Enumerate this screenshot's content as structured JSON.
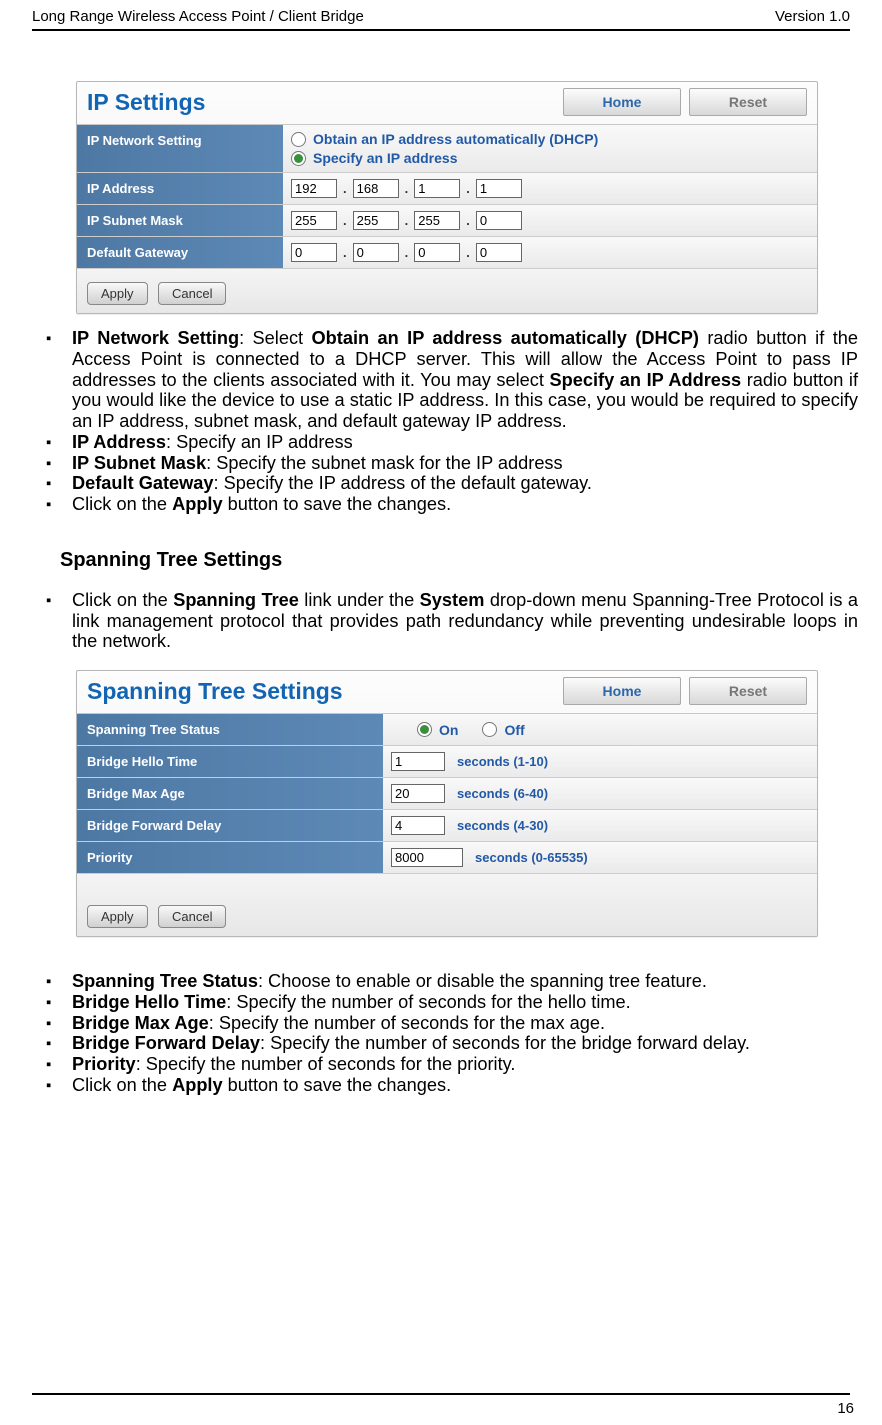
{
  "header": {
    "left": "Long Range Wireless Access Point / Client Bridge",
    "right": "Version 1.0"
  },
  "ip": {
    "title": "IP Settings",
    "btn_home": "Home",
    "btn_reset": "Reset",
    "rows": {
      "netset": "IP Network Setting",
      "opt_dhcp": "Obtain an IP address automatically (DHCP)",
      "opt_static": "Specify an IP address",
      "addr": "IP Address",
      "mask": "IP Subnet Mask",
      "gw": "Default Gateway"
    },
    "vals": {
      "addr": [
        "192",
        "168",
        "1",
        "1"
      ],
      "mask": [
        "255",
        "255",
        "255",
        "0"
      ],
      "gw": [
        "0",
        "0",
        "0",
        "0"
      ]
    },
    "apply": "Apply",
    "cancel": "Cancel"
  },
  "stp": {
    "title": "Spanning Tree Settings",
    "btn_home": "Home",
    "btn_reset": "Reset",
    "rows": {
      "status": "Spanning Tree Status",
      "on": "On",
      "off": "Off",
      "hello": "Bridge Hello Time",
      "hello_r": "seconds (1-10)",
      "max": "Bridge Max Age",
      "max_r": "seconds (6-40)",
      "fwd": "Bridge Forward Delay",
      "fwd_r": "seconds (4-30)",
      "prio": "Priority",
      "prio_r": "seconds (0-65535)"
    },
    "vals": {
      "hello": "1",
      "max": "20",
      "fwd": "4",
      "prio": "8000"
    },
    "apply": "Apply",
    "cancel": "Cancel"
  },
  "text": {
    "ip_b1_a": "IP Network Setting",
    "ip_b1_b": "Obtain an IP address automatically (DHCP)",
    "ip_b1_c": "Specify an IP Address",
    "ip_b1": ": Select ",
    "ip_b1_2": " radio button if the Access Point is connected to a DHCP server. This will allow the Access Point to pass IP addresses to the clients associated with it. You may select ",
    "ip_b1_3": " radio button if you would like the device to use a static IP address. In this case, you would be required to specify an IP address, subnet mask, and default gateway IP address.",
    "ip_b2_a": "IP Address",
    "ip_b2": ": Specify an IP address",
    "ip_b3_a": "IP Subnet Mask",
    "ip_b3": ": Specify the subnet mask for the IP address",
    "ip_b4_a": "Default Gateway",
    "ip_b4": ": Specify the IP address of the default gateway.",
    "ip_b5_1": "Click on the ",
    "ip_b5_a": "Apply",
    "ip_b5_2": " button to save the changes.",
    "stp_h": "Spanning Tree Settings",
    "stp_b0_1": "Click on the ",
    "stp_b0_a": "Spanning Tree",
    "stp_b0_2": " link under the ",
    "stp_b0_b": "System",
    "stp_b0_3": " drop-down menu Spanning-Tree Protocol is a link management protocol that provides path redundancy while preventing undesirable loops in the network.",
    "stp_b1_a": "Spanning Tree Status",
    "stp_b1": ": Choose to enable or disable the spanning tree feature.",
    "stp_b2_a": "Bridge Hello Time",
    "stp_b2": ": Specify the number of seconds for the hello time.",
    "stp_b3_a": "Bridge Max Age",
    "stp_b3": ": Specify the number of seconds for the max age.",
    "stp_b4_a": "Bridge Forward Delay",
    "stp_b4": ": Specify the number of seconds for the bridge forward delay.",
    "stp_b5_a": "Priority",
    "stp_b5": ": Specify the number of seconds for the priority.",
    "stp_b6_1": "Click on the ",
    "stp_b6_a": "Apply",
    "stp_b6_2": " button to save the changes."
  },
  "page_no": "16"
}
